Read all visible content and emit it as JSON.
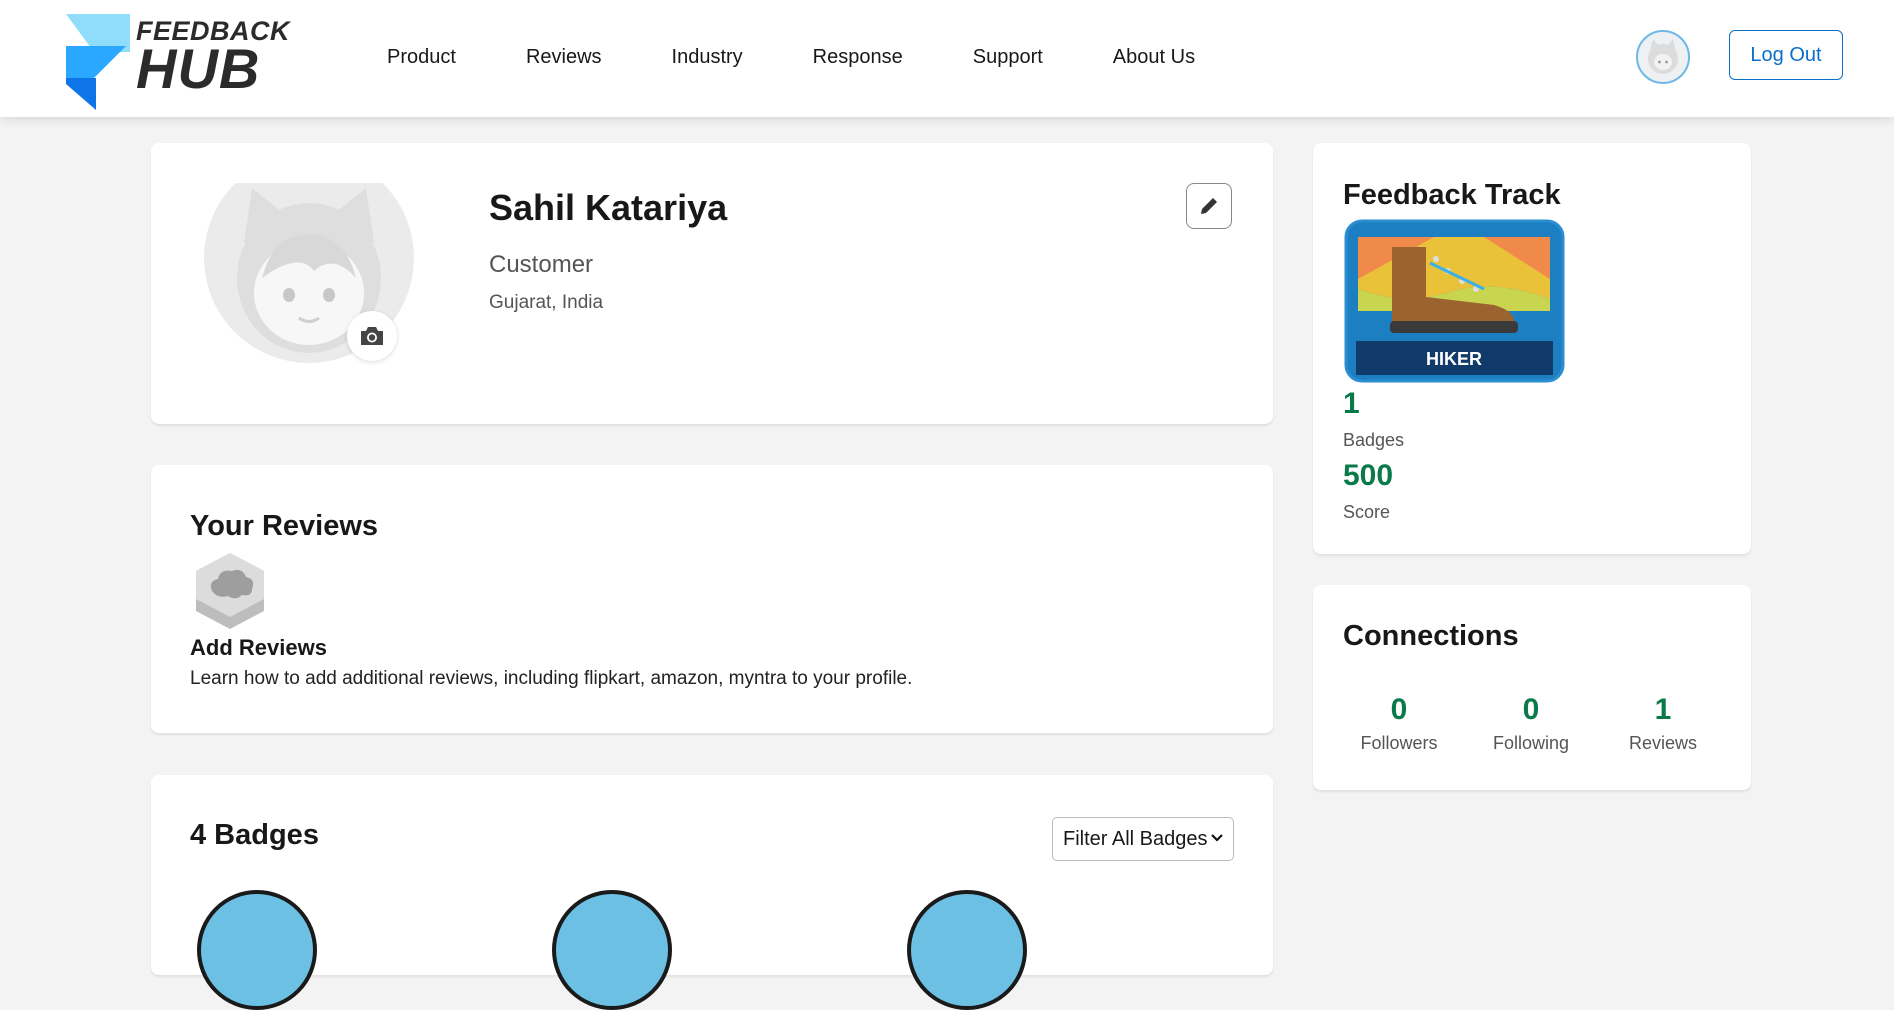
{
  "header": {
    "logo": {
      "line1": "FEEDBACK",
      "line2": "HUB"
    },
    "nav": [
      "Product",
      "Reviews",
      "Industry",
      "Response",
      "Support",
      "About Us"
    ],
    "logout_label": "Log Out"
  },
  "profile": {
    "name": "Sahil Katariya",
    "role": "Customer",
    "location": "Gujarat, India"
  },
  "reviews": {
    "title": "Your Reviews",
    "add_title": "Add Reviews",
    "add_desc": "Learn how to add additional reviews, including flipkart, amazon, myntra to your profile."
  },
  "badges": {
    "title": "4 Badges",
    "filter_selected": "Filter All Badges"
  },
  "track": {
    "title": "Feedback Track",
    "badge_label": "HIKER",
    "badges_count": "1",
    "badges_label": "Badges",
    "score": "500",
    "score_label": "Score"
  },
  "connections": {
    "title": "Connections",
    "items": [
      {
        "value": "0",
        "label": "Followers"
      },
      {
        "value": "0",
        "label": "Following"
      },
      {
        "value": "1",
        "label": "Reviews"
      }
    ]
  },
  "colors": {
    "accent_blue": "#0b6fc9",
    "stat_green": "#0a7a4a",
    "logo_blue": "#1a8fff"
  }
}
